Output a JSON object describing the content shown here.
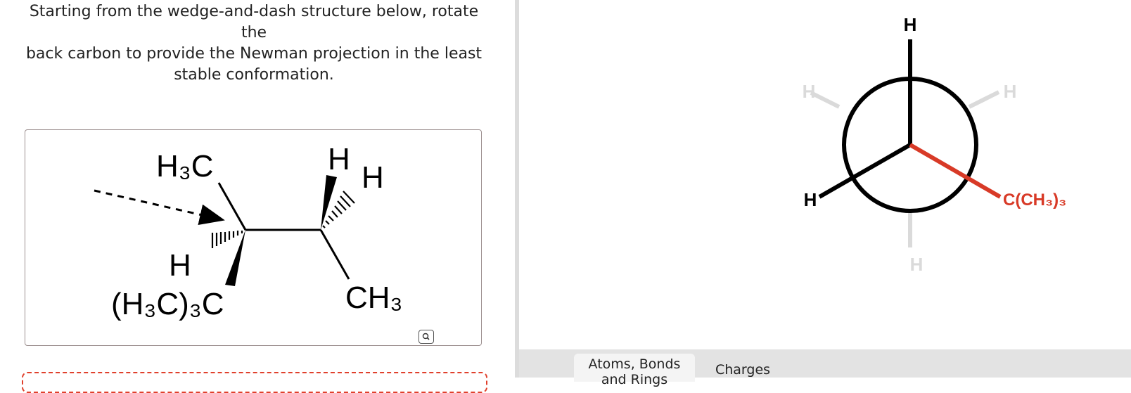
{
  "question": {
    "line1": "Starting from the wedge-and-dash structure below, rotate the",
    "line2": "back carbon to provide the Newman projection in the least",
    "line3": "stable conformation."
  },
  "structure": {
    "labels": {
      "h3c_top": "H₃C",
      "h_left": "H",
      "h3c3c": "(H₃C)₃C",
      "h_top1": "H",
      "h_top2": "H",
      "ch3": "CH₃"
    }
  },
  "newman": {
    "front": {
      "top": "H",
      "left": "H",
      "right": "C(CH₃)₃"
    },
    "back": {
      "upper_left": "H",
      "upper_right": "H",
      "bottom": "H"
    },
    "colors": {
      "front_bonds": "#000000",
      "highlight": "#d83a27",
      "back_bonds": "#dadada"
    }
  },
  "toolbar": {
    "tab_atoms_line1": "Atoms, Bonds",
    "tab_atoms_line2": "and Rings",
    "tab_charges": "Charges"
  },
  "icons": {
    "zoom": "magnifier-zoom-icon"
  }
}
